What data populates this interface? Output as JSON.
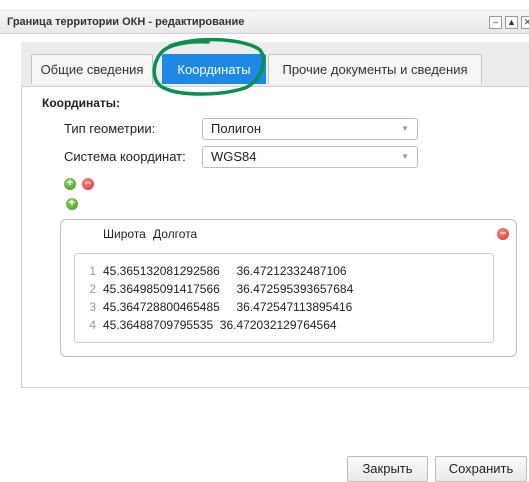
{
  "window": {
    "title": "Граница территории ОКН - редактирование",
    "buttons": [
      "–",
      "▲",
      "✕"
    ]
  },
  "tabs": [
    {
      "label": "Общие сведения",
      "active": false
    },
    {
      "label": "Координаты",
      "active": true
    },
    {
      "label": "Прочие документы и сведения",
      "active": false
    }
  ],
  "coordinates": {
    "section_label": "Координаты:",
    "geometry_type_label": "Тип геометрии:",
    "geometry_type_value": "Полигон",
    "crs_label": "Система координат:",
    "crs_value": "WGS84",
    "columns": {
      "lat": "Широта",
      "lon": "Долгота"
    },
    "rows": [
      {
        "n": "1",
        "text": "45.365132081292586     36.47212332487106"
      },
      {
        "n": "2",
        "text": "45.364985091417566     36.472595393657684"
      },
      {
        "n": "3",
        "text": "45.364728800465485     36.472547113895416"
      },
      {
        "n": "4",
        "text": "45.36488709795535  36.472032129764564"
      }
    ]
  },
  "footer": {
    "close_label": "Закрыть",
    "save_label": "Сохранить"
  },
  "colors": {
    "accent": "#1e88e5",
    "annotation": "#0a8f4f"
  }
}
